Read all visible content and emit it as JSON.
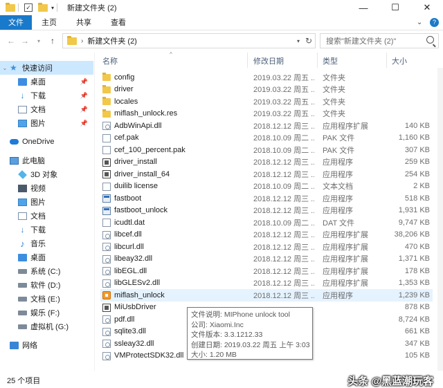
{
  "window": {
    "title": "新建文件夹 (2)",
    "minimize": "—",
    "maximize": "☐",
    "close": "✕"
  },
  "ribbon": {
    "tabs": [
      "文件",
      "主页",
      "共享",
      "查看"
    ],
    "collapse": "⌄",
    "help": "?"
  },
  "address": {
    "path": "新建文件夹 (2)",
    "search_placeholder": "搜索\"新建文件夹 (2)\""
  },
  "nav": {
    "quick_access": "快速访问",
    "desktop": "桌面",
    "downloads": "下载",
    "documents": "文档",
    "pictures": "图片",
    "onedrive": "OneDrive",
    "this_pc": "此电脑",
    "objects3d": "3D 对象",
    "videos": "视频",
    "pc_pictures": "图片",
    "pc_documents": "文档",
    "pc_downloads": "下载",
    "music": "音乐",
    "pc_desktop": "桌面",
    "drive_c": "系统 (C:)",
    "drive_d": "软件 (D:)",
    "drive_e": "文档 (E:)",
    "drive_f": "娱乐 (F:)",
    "drive_g": "虚拟机 (G:)",
    "network": "网络"
  },
  "columns": {
    "name": "名称",
    "date": "修改日期",
    "type": "类型",
    "size": "大小"
  },
  "files": [
    {
      "name": "config",
      "date": "2019.03.22 周五 ...",
      "type": "文件夹",
      "size": "",
      "icon": "folder"
    },
    {
      "name": "driver",
      "date": "2019.03.22 周五 ...",
      "type": "文件夹",
      "size": "",
      "icon": "folder"
    },
    {
      "name": "locales",
      "date": "2019.03.22 周五 ...",
      "type": "文件夹",
      "size": "",
      "icon": "folder"
    },
    {
      "name": "miflash_unlock.res",
      "date": "2019.03.22 周五 ...",
      "type": "文件夹",
      "size": "",
      "icon": "folder"
    },
    {
      "name": "AdbWinApi.dll",
      "date": "2018.12.12 周三 ...",
      "type": "应用程序扩展",
      "size": "140 KB",
      "icon": "dll"
    },
    {
      "name": "cef.pak",
      "date": "2018.10.09 周二 ...",
      "type": "PAK 文件",
      "size": "1,160 KB",
      "icon": "file"
    },
    {
      "name": "cef_100_percent.pak",
      "date": "2018.10.09 周二 ...",
      "type": "PAK 文件",
      "size": "307 KB",
      "icon": "file"
    },
    {
      "name": "driver_install",
      "date": "2018.12.12 周三 ...",
      "type": "应用程序",
      "size": "259 KB",
      "icon": "installer"
    },
    {
      "name": "driver_install_64",
      "date": "2018.12.12 周三 ...",
      "type": "应用程序",
      "size": "254 KB",
      "icon": "installer"
    },
    {
      "name": "duilib license",
      "date": "2018.10.09 周二 ...",
      "type": "文本文档",
      "size": "2 KB",
      "icon": "file"
    },
    {
      "name": "fastboot",
      "date": "2018.12.12 周三 ...",
      "type": "应用程序",
      "size": "518 KB",
      "icon": "exe"
    },
    {
      "name": "fastboot_unlock",
      "date": "2018.12.12 周三 ...",
      "type": "应用程序",
      "size": "1,931 KB",
      "icon": "exe"
    },
    {
      "name": "icudtl.dat",
      "date": "2018.10.09 周二 ...",
      "type": "DAT 文件",
      "size": "9,747 KB",
      "icon": "file"
    },
    {
      "name": "libcef.dll",
      "date": "2018.12.12 周三 ...",
      "type": "应用程序扩展",
      "size": "38,206 KB",
      "icon": "dll"
    },
    {
      "name": "libcurl.dll",
      "date": "2018.12.12 周三 ...",
      "type": "应用程序扩展",
      "size": "470 KB",
      "icon": "dll"
    },
    {
      "name": "libeay32.dll",
      "date": "2018.12.12 周三 ...",
      "type": "应用程序扩展",
      "size": "1,371 KB",
      "icon": "dll"
    },
    {
      "name": "libEGL.dll",
      "date": "2018.12.12 周三 ...",
      "type": "应用程序扩展",
      "size": "178 KB",
      "icon": "dll"
    },
    {
      "name": "libGLESv2.dll",
      "date": "2018.12.12 周三 ...",
      "type": "应用程序扩展",
      "size": "1,353 KB",
      "icon": "dll"
    },
    {
      "name": "miflash_unlock",
      "date": "2018.12.12 周三 ...",
      "type": "应用程序",
      "size": "1,239 KB",
      "icon": "mi"
    },
    {
      "name": "MiUsbDriver",
      "date": "",
      "type": "",
      "size": "878 KB",
      "icon": "installer"
    },
    {
      "name": "pdf.dll",
      "date": "",
      "type": "",
      "size": "8,724 KB",
      "icon": "dll"
    },
    {
      "name": "sqlite3.dll",
      "date": "",
      "type": "",
      "size": "661 KB",
      "icon": "dll"
    },
    {
      "name": "ssleay32.dll",
      "date": "",
      "type": "",
      "size": "347 KB",
      "icon": "dll"
    },
    {
      "name": "VMProtectSDK32.dll",
      "date": "",
      "type": "",
      "size": "105 KB",
      "icon": "dll"
    }
  ],
  "tooltip": {
    "desc": "文件说明: MIPhone unlock tool",
    "company": "公司: Xiaomi.Inc",
    "version": "文件版本: 3.3.1212.33",
    "created": "创建日期: 2019.03.22 周五 上午 3:03",
    "size": "大小: 1.20 MB"
  },
  "status": {
    "count": "25 个项目"
  },
  "watermark": "头条 @黑蓝潮玩客"
}
